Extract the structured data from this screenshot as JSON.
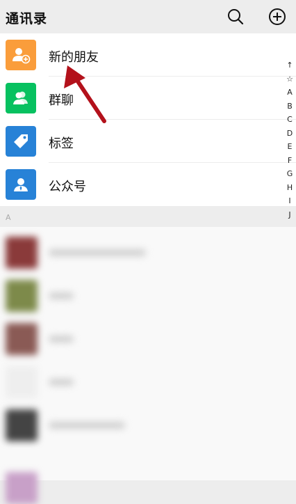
{
  "header": {
    "title": "通讯录",
    "search_icon": "search-icon",
    "add_icon": "plus-circle-icon"
  },
  "entries": [
    {
      "label": "新的朋友",
      "icon": "add-friend-icon",
      "color": "#fa9d3b"
    },
    {
      "label": "群聊",
      "icon": "group-icon",
      "color": "#07c160"
    },
    {
      "label": "标签",
      "icon": "tag-icon",
      "color": "#2782d7"
    },
    {
      "label": "公众号",
      "icon": "official-account-icon",
      "color": "#2782d7"
    }
  ],
  "index_bar": [
    "↑",
    "☆",
    "A",
    "B",
    "C",
    "D",
    "E",
    "F",
    "G",
    "H",
    "I",
    "J"
  ],
  "section": {
    "letter": "A"
  },
  "annotation": {
    "arrow_color": "#b3111b"
  }
}
